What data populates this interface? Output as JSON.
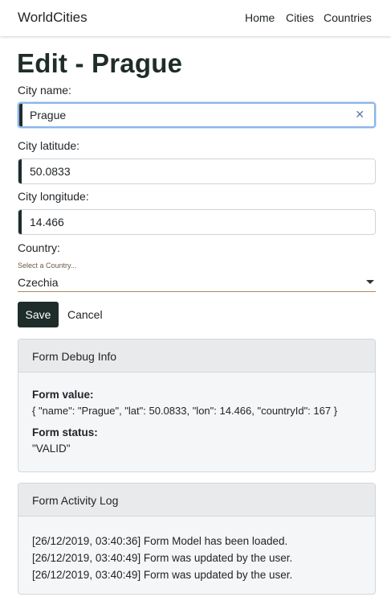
{
  "navbar": {
    "brand": "WorldCities",
    "links": [
      "Home",
      "Cities",
      "Countries"
    ]
  },
  "page": {
    "title": "Edit - Prague"
  },
  "form": {
    "name_label": "City name:",
    "name_value": "Prague",
    "clear_glyph": "✕",
    "lat_label": "City latitude:",
    "lat_value": "50.0833",
    "lon_label": "City longitude:",
    "lon_value": "14.466",
    "country_label": "Country:",
    "country_placeholder": "Select a Country...",
    "country_value": "Czechia",
    "save_label": "Save",
    "cancel_label": "Cancel"
  },
  "debug": {
    "header": "Form Debug Info",
    "value_label": "Form value:",
    "value_text": "{ \"name\": \"Prague\", \"lat\": 50.0833, \"lon\": 14.466, \"countryId\": 167 }",
    "status_label": "Form status:",
    "status_text": "\"VALID\""
  },
  "activity": {
    "header": "Form Activity Log",
    "entries": [
      "[26/12/2019, 03:40:36] Form Model has been loaded.",
      "[26/12/2019, 03:40:49] Form was updated by the user.",
      "[26/12/2019, 03:40:49] Form was updated by the user."
    ]
  },
  "colors": {
    "accent": "#1f2d2a",
    "focus_border": "#8ab6e8",
    "select_underline": "#b08b5a"
  }
}
